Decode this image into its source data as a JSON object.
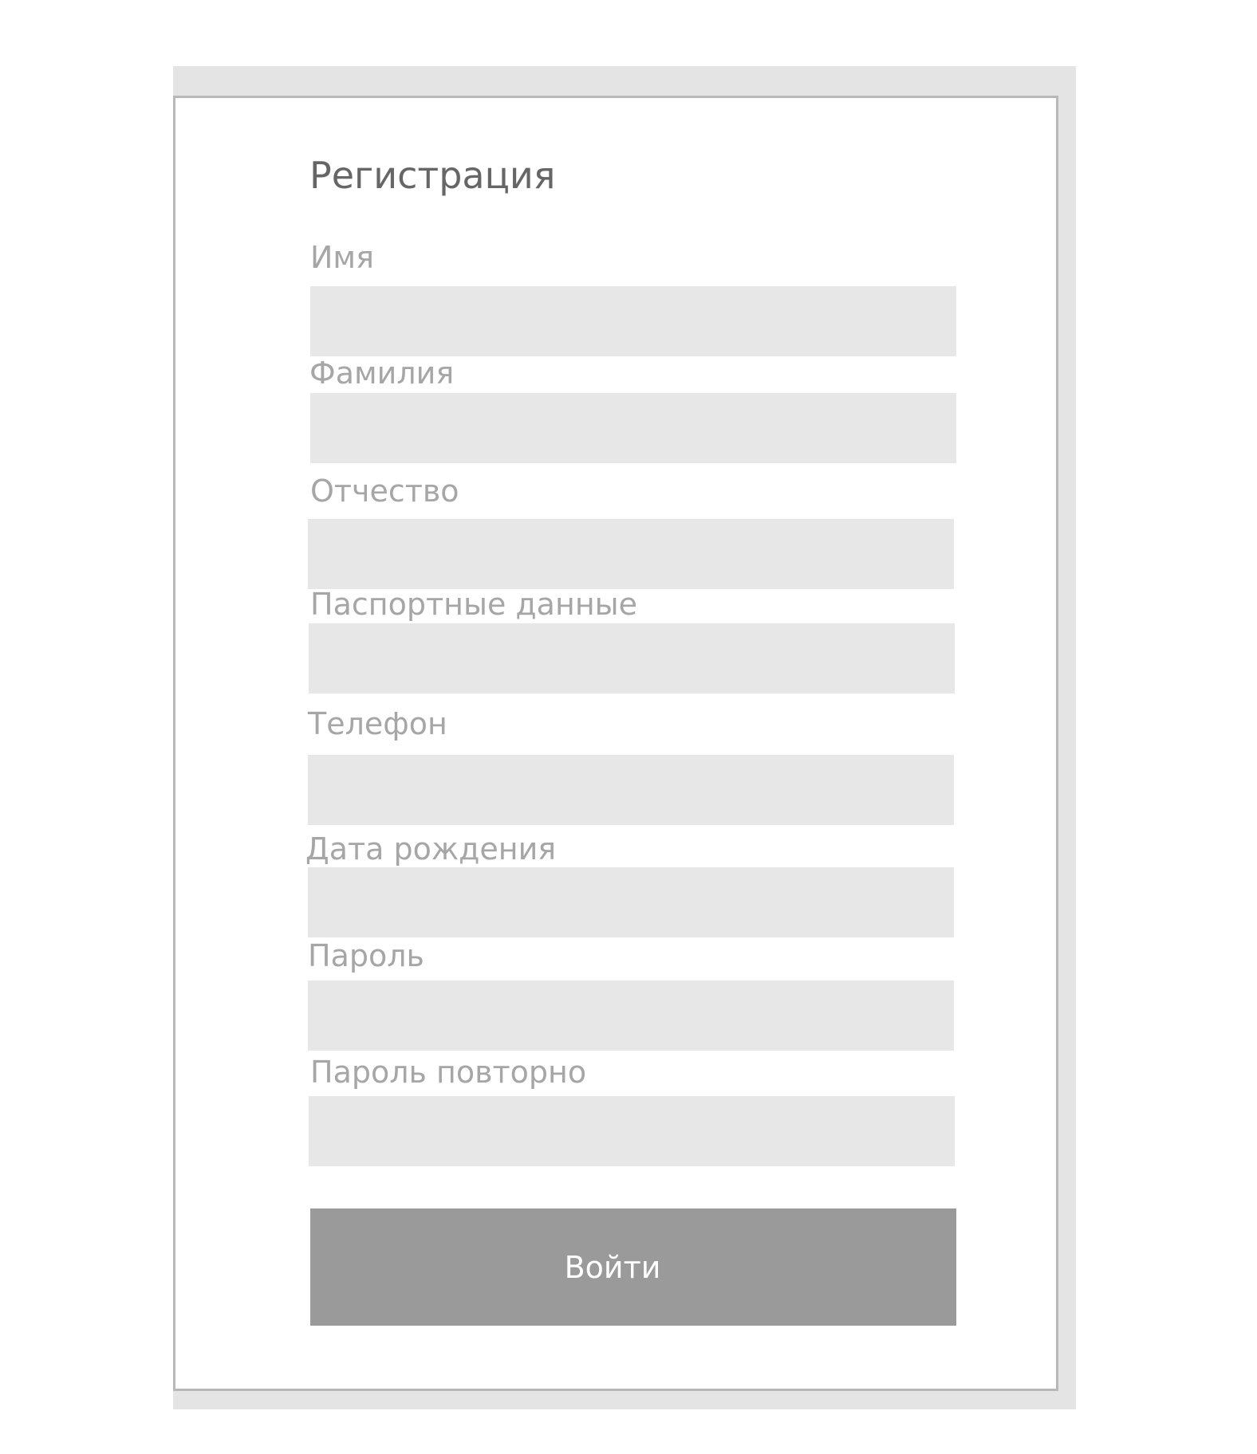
{
  "form": {
    "title": "Регистрация",
    "fields": [
      {
        "label": "Имя",
        "value": ""
      },
      {
        "label": "Фамилия",
        "value": ""
      },
      {
        "label": "Отчество",
        "value": ""
      },
      {
        "label": "Паспортные данные",
        "value": ""
      },
      {
        "label": "Телефон",
        "value": ""
      },
      {
        "label": "Дата рождения",
        "value": ""
      },
      {
        "label": "Пароль",
        "value": ""
      },
      {
        "label": "Пароль повторно",
        "value": ""
      }
    ],
    "submit_label": "Войти"
  }
}
